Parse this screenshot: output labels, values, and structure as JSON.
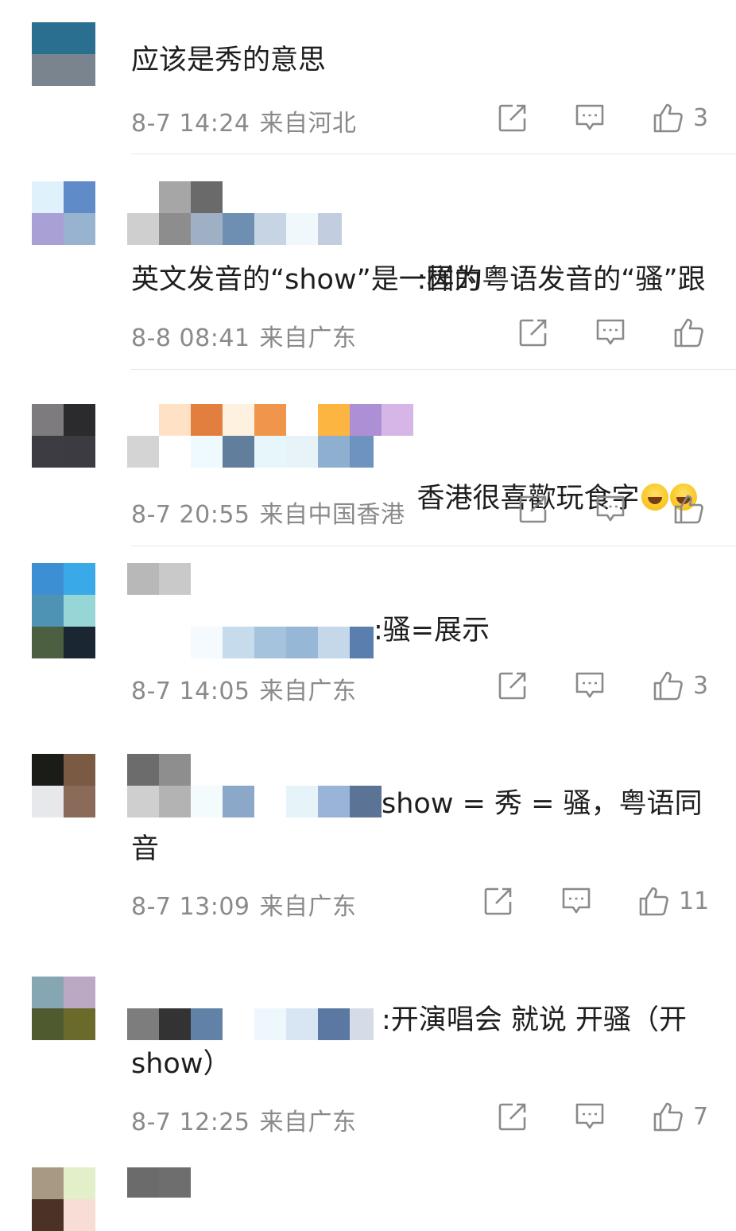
{
  "comments": [
    {
      "text": "应该是秀的意思",
      "date": "8-7 14:24",
      "location": "来自河北",
      "likes": "3"
    },
    {
      "text_line1": ":因为粤语发音的“骚”跟",
      "text_line2": "英文发音的“show”是一样的",
      "date": "8-8 08:41",
      "location": "来自广东",
      "likes": ""
    },
    {
      "text": "香港很喜歡玩食字",
      "emoji": [
        "grin-tears-emoji",
        "grin-tears-emoji"
      ],
      "date": "8-7 20:55",
      "location": "来自中国香港",
      "likes": ""
    },
    {
      "text": ":骚=展示",
      "date": "8-7 14:05",
      "location": "来自广东",
      "likes": "3"
    },
    {
      "text_line1": "show = 秀 = 骚，粤语同",
      "text_line2": "音",
      "date": "8-7 13:09",
      "location": "来自广东",
      "likes": "11"
    },
    {
      "text_line1": ":开演唱会 就说 开骚（开",
      "text_line2": "show）",
      "date": "8-7 12:25",
      "location": "来自广东",
      "likes": "7"
    }
  ],
  "colors": {
    "text": "#1e1e1e",
    "meta": "#8a8a8a",
    "divider": "#e6e6e6",
    "icon": "#8a8a8a"
  },
  "icons": [
    "share-icon",
    "comment-icon",
    "like-icon"
  ]
}
